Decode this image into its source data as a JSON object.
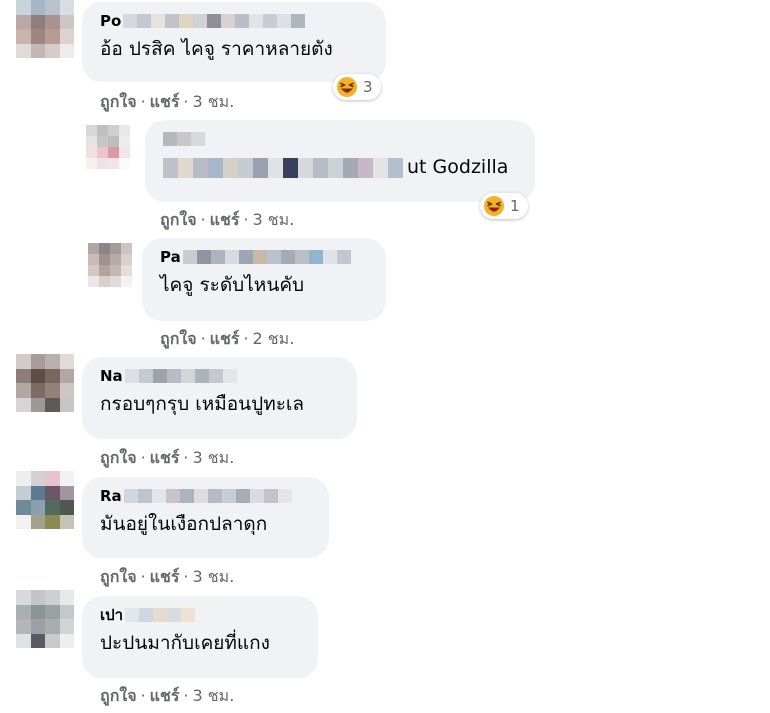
{
  "comments": [
    {
      "name_prefix": "Po",
      "text": "อ้อ ปรสิค ไคจู ราคาหลายตัง",
      "reaction_count": "3",
      "like": "ถูกใจ",
      "share": "แชร์",
      "time": "3 ชม."
    },
    {
      "name_prefix": "",
      "text_suffix": "ut Godzilla",
      "reaction_count": "1",
      "like": "ถูกใจ",
      "share": "แชร์",
      "time": "3 ชม."
    },
    {
      "name_prefix": "Pa",
      "text": "ไคจู ระดับไหนคับ",
      "like": "ถูกใจ",
      "share": "แชร์",
      "time": "2 ชม."
    },
    {
      "name_prefix": "Na",
      "text": "กรอบๆกรุบ เหมือนปูทะเล",
      "like": "ถูกใจ",
      "share": "แชร์",
      "time": "3 ชม."
    },
    {
      "name_prefix": "Ra",
      "text": "มันอยู่ในเงือกปลาดุก",
      "like": "ถูกใจ",
      "share": "แชร์",
      "time": "3 ชม."
    },
    {
      "name_prefix": "เปา",
      "text": "ปะปนมากับเคยที่แกง",
      "like": "ถูกใจ",
      "share": "แชร์",
      "time": "3 ชม."
    }
  ],
  "reaction_icon": "laughing-emoji-icon",
  "colors": {
    "bubble": "#f0f2f5",
    "meta_text": "#65676b",
    "emoji_yellow": "#f7b125"
  }
}
